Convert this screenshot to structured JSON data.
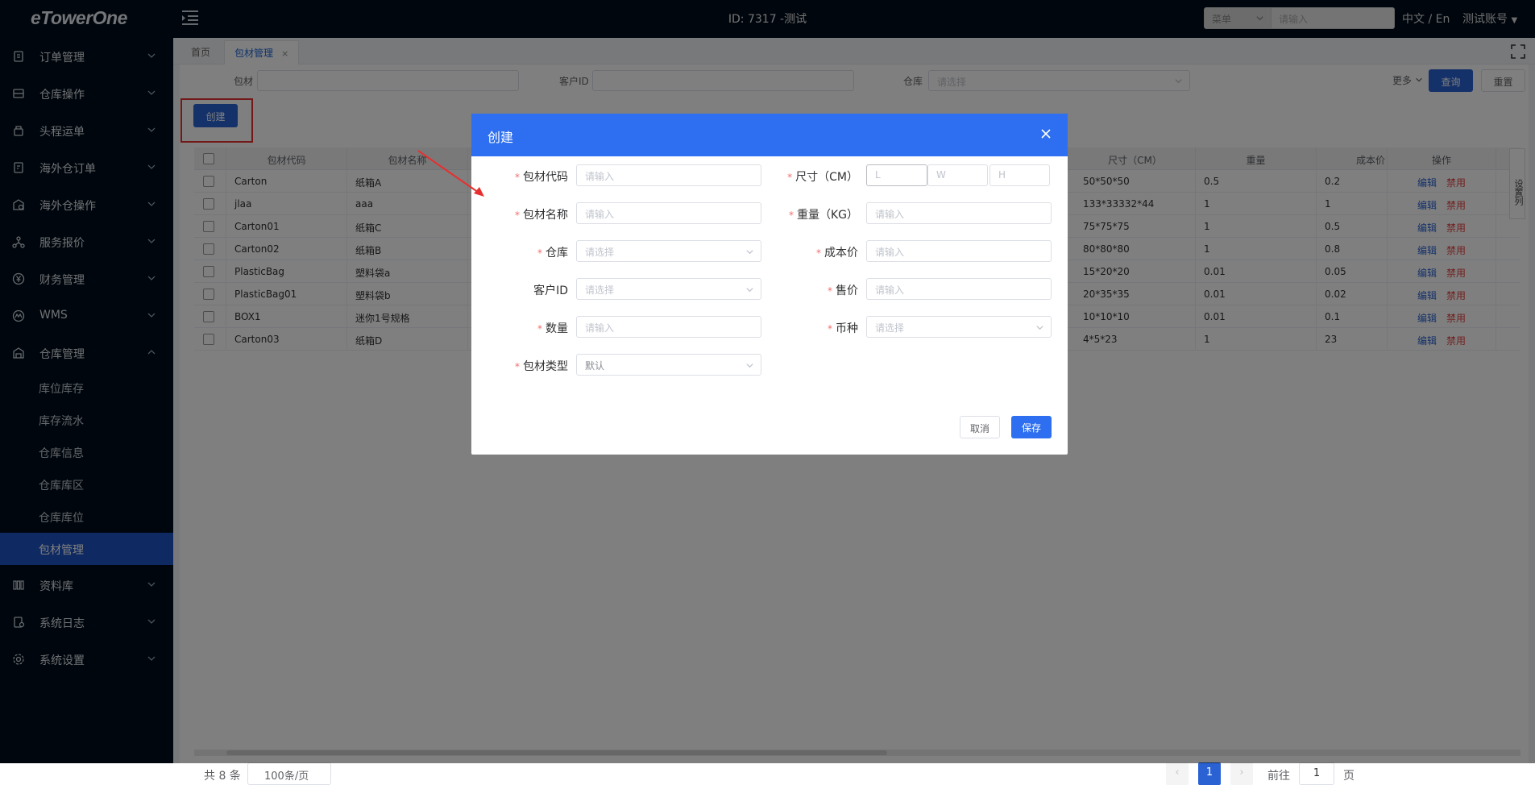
{
  "topbar": {
    "logo": "eTowerOne",
    "page_id": "ID: 7317 -测试",
    "search_select": "菜单",
    "search_placeholder": "请输入",
    "lang": "中文 / En",
    "account": "测试账号"
  },
  "sidebar": {
    "items": [
      {
        "label": "订单管理",
        "icon": "order-icon"
      },
      {
        "label": "仓库操作",
        "icon": "warehouse-operation-icon"
      },
      {
        "label": "头程运单",
        "icon": "shipment-icon"
      },
      {
        "label": "海外仓订单",
        "icon": "overseas-order-icon"
      },
      {
        "label": "海外仓操作",
        "icon": "overseas-operation-icon"
      },
      {
        "label": "服务报价",
        "icon": "quote-icon"
      },
      {
        "label": "财务管理",
        "icon": "finance-icon"
      },
      {
        "label": "WMS",
        "icon": "wms-icon"
      },
      {
        "label": "仓库管理",
        "icon": "warehouse-management-icon",
        "expanded": true
      }
    ],
    "subitems": [
      "库位库存",
      "库存流水",
      "仓库信息",
      "仓库库区",
      "仓库库位",
      "包材管理"
    ],
    "active_subitem": "包材管理",
    "lower_items": [
      {
        "label": "资料库",
        "icon": "library-icon"
      },
      {
        "label": "系统日志",
        "icon": "log-icon"
      },
      {
        "label": "系统设置",
        "icon": "settings-icon"
      }
    ]
  },
  "tabs": [
    {
      "label": "首页"
    },
    {
      "label": "包材管理",
      "close": "×",
      "active": true
    }
  ],
  "filters": {
    "packaging_label": "包材",
    "customer_label": "客户ID",
    "warehouse_label": "仓库",
    "warehouse_placeholder": "请选择",
    "more": "更多",
    "query": "查询",
    "reset": "重置"
  },
  "create_button": "创建",
  "table": {
    "headers": [
      "包材代码",
      "包材名称",
      "尺寸（CM）",
      "重量",
      "成本价",
      "操作"
    ],
    "rows": [
      {
        "code": "Carton",
        "name": "纸箱A",
        "size": "50*50*50",
        "weight": "0.5",
        "cost": "0.2"
      },
      {
        "code": "jlaa",
        "name": "aaa",
        "size": "133*33332*44",
        "weight": "1",
        "cost": "1"
      },
      {
        "code": "Carton01",
        "name": "纸箱C",
        "size": "75*75*75",
        "weight": "1",
        "cost": "0.5"
      },
      {
        "code": "Carton02",
        "name": "纸箱B",
        "size": "80*80*80",
        "weight": "1",
        "cost": "0.8"
      },
      {
        "code": "PlasticBag",
        "name": "塑料袋a",
        "size": "15*20*20",
        "weight": "0.01",
        "cost": "0.05"
      },
      {
        "code": "PlasticBag01",
        "name": "塑料袋b",
        "size": "20*35*35",
        "weight": "0.01",
        "cost": "0.02"
      },
      {
        "code": "BOX1",
        "name": "迷你1号规格",
        "size": "10*10*10",
        "weight": "0.01",
        "cost": "0.1"
      },
      {
        "code": "Carton03",
        "name": "纸箱D",
        "size": "4*5*23",
        "weight": "1",
        "cost": "23"
      }
    ],
    "edit_label": "编辑",
    "disable_label": "禁用",
    "column_settings": "设置列"
  },
  "pagination": {
    "total": "共 8 条",
    "page_size": "100条/页",
    "current_page": "1",
    "goto_label": "前往",
    "goto_value": "1",
    "page_suffix": "页"
  },
  "modal": {
    "title": "创建",
    "fields_left": [
      {
        "label": "包材代码",
        "placeholder": "请输入",
        "required": true,
        "type": "input"
      },
      {
        "label": "包材名称",
        "placeholder": "请输入",
        "required": true,
        "type": "input"
      },
      {
        "label": "仓库",
        "placeholder": "请选择",
        "required": true,
        "type": "select"
      },
      {
        "label": "客户ID",
        "placeholder": "请选择",
        "required": false,
        "type": "select"
      },
      {
        "label": "数量",
        "placeholder": "请输入",
        "required": true,
        "type": "input"
      },
      {
        "label": "包材类型",
        "placeholder": "默认",
        "required": true,
        "type": "select"
      }
    ],
    "fields_right": [
      {
        "label": "尺寸（CM）",
        "required": true,
        "type": "dims",
        "placeholders": [
          "L",
          "W",
          "H"
        ]
      },
      {
        "label": "重量（KG）",
        "placeholder": "请输入",
        "required": true,
        "type": "input"
      },
      {
        "label": "成本价",
        "placeholder": "请输入",
        "required": true,
        "type": "input"
      },
      {
        "label": "售价",
        "placeholder": "请输入",
        "required": true,
        "type": "input"
      },
      {
        "label": "币种",
        "placeholder": "请选择",
        "required": true,
        "type": "select"
      }
    ],
    "required_mark": "*",
    "cancel": "取消",
    "save": "保存"
  },
  "colors": {
    "sidebar_bg": "#000c1a",
    "active_nav": "#1e55c5",
    "primary": "#2d6ff0",
    "danger": "#e34343",
    "annotation": "#e63030"
  }
}
